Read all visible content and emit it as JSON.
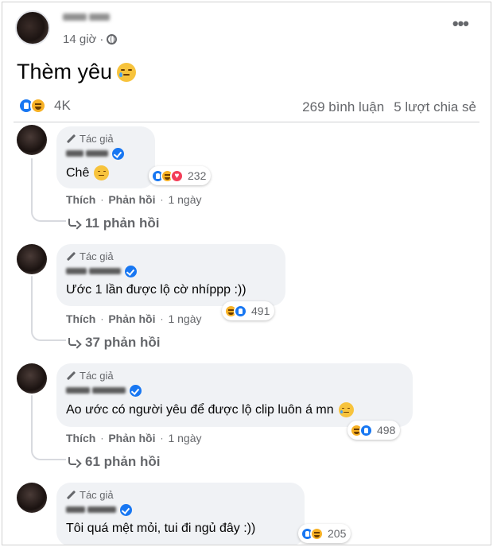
{
  "post": {
    "time": "14 giờ",
    "text": "Thèm yêu",
    "reactions_count": "4K",
    "comments_count": "269 bình luận",
    "shares_count": "5 lượt chia sẻ"
  },
  "labels": {
    "author_badge": "Tác giả",
    "like": "Thích",
    "reply": "Phản hồi",
    "dot": "·"
  },
  "comments": [
    {
      "text": "Chê",
      "emoji": "expressionless-face",
      "reactions": [
        "like-icon",
        "haha-icon",
        "love-icon"
      ],
      "reaction_count": "232",
      "time": "1 ngày",
      "replies": "11 phản hồi"
    },
    {
      "text": "Ước 1 lần được lộ cờ nhíppp :))",
      "reactions": [
        "haha-icon",
        "like-icon"
      ],
      "reaction_count": "491",
      "time": "1 ngày",
      "replies": "37 phản hồi"
    },
    {
      "text": "Ao ước có người yêu để được lộ clip luôn á mn",
      "emoji": "crying-face",
      "reactions": [
        "haha-icon",
        "like-icon"
      ],
      "reaction_count": "498",
      "time": "1 ngày",
      "replies": "61 phản hồi"
    },
    {
      "text": "Tôi quá mệt mỏi, tui đi ngủ đây :))",
      "reactions": [
        "like-icon",
        "haha-icon"
      ],
      "reaction_count": "205"
    }
  ],
  "colors": {
    "facebook_blue": "#1877f2",
    "secondary_text": "#65676b",
    "bubble_bg": "#f0f2f5"
  }
}
